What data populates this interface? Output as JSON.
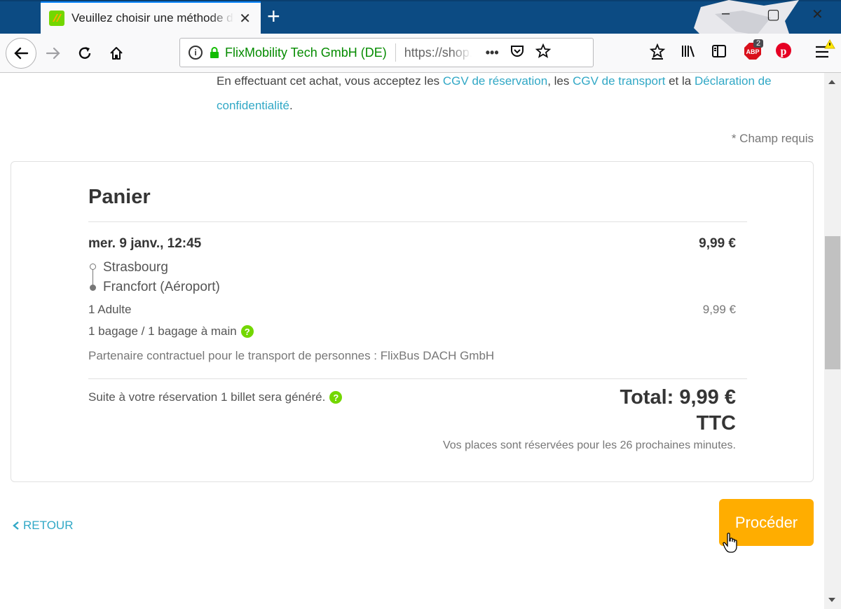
{
  "browser": {
    "tab_title": "Veuillez choisir une méthode de paiement",
    "tab_close": "✕",
    "new_tab": "+",
    "window_minimize": "–",
    "window_maximize": "▢",
    "window_close": "✕",
    "site_identity": "FlixMobility Tech GmbH (DE)",
    "url": "https://shop.flixbus.fr",
    "page_actions": "•••",
    "adblock_badge": "2",
    "icons": [
      "back-icon",
      "forward-icon",
      "reload-icon",
      "home-icon",
      "info-icon",
      "lock-icon",
      "pocket-icon",
      "bookmark-star-icon",
      "reading-list-icon",
      "library-icon",
      "sidebar-icon",
      "adblock-icon",
      "pinterest-icon",
      "menu-icon",
      "warning-icon"
    ]
  },
  "terms": {
    "prefix": "En effectuant cet achat, vous acceptez les ",
    "link1": "CGV de réservation",
    "mid1": ", les ",
    "link2": "CGV de transport",
    "mid2": " et la ",
    "link3": "Déclaration de confidentialité",
    "suffix": "."
  },
  "required_note": "* Champ requis",
  "cart": {
    "title": "Panier",
    "trip_date": "mer. 9 janv., 12:45",
    "trip_price": "9,99 €",
    "from": "Strasbourg",
    "to": "Francfort (Aéroport)",
    "passengers": "1 Adulte",
    "passengers_price": "9,99 €",
    "baggage": "1 bagage / 1 bagage à main",
    "partner": "Partenaire contractuel pour le transport de personnes : FlixBus DACH GmbH",
    "ticket_note": "Suite à votre réservation 1 billet sera généré.",
    "total_line1": "Total: 9,99 €",
    "total_line2": "TTC",
    "reservation_note": "Vos places sont réservées pour les 26 prochaines minutes."
  },
  "footer": {
    "back_label": "RETOUR",
    "proceed_label": "Procéder"
  },
  "colors": {
    "accent_link": "#31a8c6",
    "flix_green": "#73d700",
    "proceed_orange": "#ffad00",
    "tabbar_blue": "#0c4b83",
    "secure_green": "#058b00"
  }
}
